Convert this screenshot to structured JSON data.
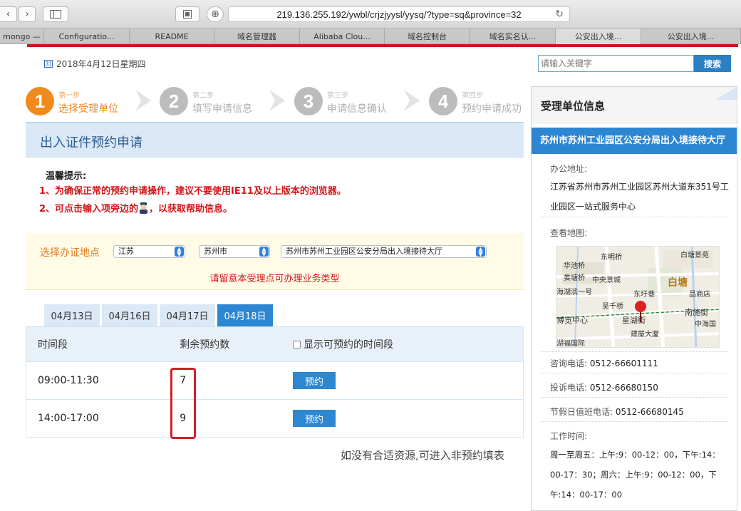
{
  "browser": {
    "url": "219.136.255.192/ywbl/crjzjyysl/yysq/?type=sq&province=32",
    "tabs": [
      "mongo —",
      "Configuratio...",
      "README",
      "域名管理器",
      "Alibaba Clou...",
      "域名控制台",
      "域名实名认...",
      "公安出入境...",
      "公安出入境..."
    ]
  },
  "header": {
    "date": "2018年4月12日星期四",
    "search_placeholder": "请输入关键字",
    "search_button": "搜索"
  },
  "steps": [
    {
      "num": "1",
      "sub": "第一步",
      "label": "选择受理单位",
      "active": true
    },
    {
      "num": "2",
      "sub": "第二步",
      "label": "填写申请信息",
      "active": false
    },
    {
      "num": "3",
      "sub": "第三步",
      "label": "申请信息确认",
      "active": false
    },
    {
      "num": "4",
      "sub": "第四步",
      "label": "预约申请成功",
      "active": false
    }
  ],
  "main": {
    "title": "出入证件预约申请",
    "tips_title": "温馨提示:",
    "tip1": "1、为确保正常的预约申请操作，建议不要使用IE11及以上版本的浏览器。",
    "tip2_before": "2、可点击输入项旁边的",
    "tip2_after": "，以获取帮助信息。",
    "location_label": "选择办证地点",
    "province": "江苏",
    "city": "苏州市",
    "office": "苏州市苏州工业园区公安分局出入境接待大厅",
    "location_note": "请留意本受理点可办理业务类型",
    "date_tabs": [
      "04月13日",
      "04月16日",
      "04月17日",
      "04月18日"
    ],
    "active_date_index": 3,
    "table_headers": [
      "时间段",
      "剩余预约数",
      "显示可预约的时间段"
    ],
    "slots": [
      {
        "time": "09:00-11:30",
        "remaining": "7",
        "action": "预约"
      },
      {
        "time": "14:00-17:00",
        "remaining": "9",
        "action": "预约"
      }
    ],
    "non_reservation_text": "如没有合适资源,可进入非预约填表"
  },
  "office_info": {
    "heading": "受理单位信息",
    "name": "苏州市苏州工业园区公安分局出入境接待大厅",
    "address_label": "办公地址:",
    "address": "江苏省苏州市苏州工业园区苏州大道东351号工业园区一站式服务中心",
    "map_label": "查看地图:",
    "map_labels": [
      "东明桥",
      "白塘景苑",
      "华池桥",
      "娄塘桥",
      "中央景城",
      "白塘",
      "海湖滨一号",
      "东圩巷",
      "品商店",
      "吴千桥",
      "南施街",
      "博览中心",
      "星湖街",
      "中海国",
      "建屋大厦",
      "湖福国际"
    ],
    "consult_label": "咨询电话:",
    "consult_phone": "0512-66601111",
    "complaint_label": "投诉电话:",
    "complaint_phone": "0512-66680150",
    "holiday_label": "节假日值班电话:",
    "holiday_phone": "0512-66680145",
    "hours_label": "工作时间:",
    "hours": "周一至周五：上午:9：00-12：00，下午:14：00-17：30；周六：上午:9：00-12：00，下午:14：00-17：00"
  }
}
